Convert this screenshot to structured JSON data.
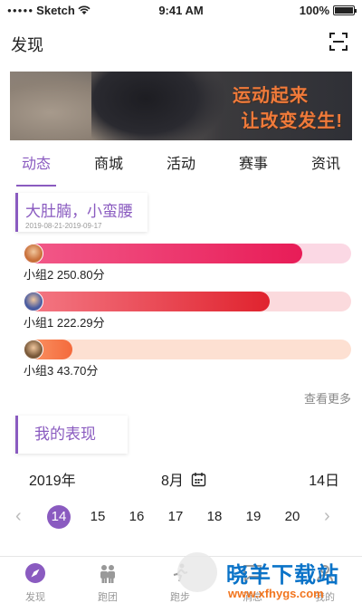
{
  "status": {
    "carrier": "Sketch",
    "time": "9:41 AM",
    "battery": "100%"
  },
  "nav": {
    "title": "发现",
    "scan_icon": "scan-icon"
  },
  "banner": {
    "line1": "运动起来",
    "line2": "让改变发生!"
  },
  "tabs": [
    {
      "label": "动态",
      "active": true
    },
    {
      "label": "商城",
      "active": false
    },
    {
      "label": "活动",
      "active": false
    },
    {
      "label": "赛事",
      "active": false
    },
    {
      "label": "资讯",
      "active": false
    }
  ],
  "event": {
    "title": "大肚腩，小蛮腰",
    "date_range": "2019-08-21-2019-09-17"
  },
  "ranking": [
    {
      "label": "小组2  250.80分",
      "fill": 0.85,
      "colors": [
        "#f25a8a",
        "#e81c57"
      ],
      "track": "#fbd8e4",
      "avatar": "#c9703a"
    },
    {
      "label": "小组1  222.29分",
      "fill": 0.75,
      "colors": [
        "#f47a86",
        "#e0232e"
      ],
      "track": "#fbdadd",
      "avatar": "#4a5ca0"
    },
    {
      "label": "小组3  43.70分",
      "fill": 0.15,
      "colors": [
        "#fb9a6a",
        "#f46a3c"
      ],
      "track": "#fde0d2",
      "avatar": "#7a5a3a"
    }
  ],
  "more": "查看更多",
  "performance": {
    "title": "我的表现"
  },
  "date": {
    "year": "2019年",
    "month": "8月",
    "day": "14日"
  },
  "days": [
    {
      "label": "14",
      "active": true
    },
    {
      "label": "15",
      "active": false
    },
    {
      "label": "16",
      "active": false
    },
    {
      "label": "17",
      "active": false
    },
    {
      "label": "18",
      "active": false
    },
    {
      "label": "19",
      "active": false
    },
    {
      "label": "20",
      "active": false
    }
  ],
  "tabbar": [
    {
      "label": "发现",
      "icon": "compass-icon",
      "active": true
    },
    {
      "label": "跑团",
      "icon": "group-icon",
      "active": false
    },
    {
      "label": "跑步",
      "icon": "run-icon",
      "active": false
    },
    {
      "label": "消息",
      "icon": "message-icon",
      "active": false
    },
    {
      "label": "我的",
      "icon": "profile-icon",
      "active": false
    }
  ],
  "watermark": {
    "logo": "晓羊下载站",
    "url": "www.xfhygs.com"
  },
  "colors": {
    "accent": "#8a5bc0"
  }
}
